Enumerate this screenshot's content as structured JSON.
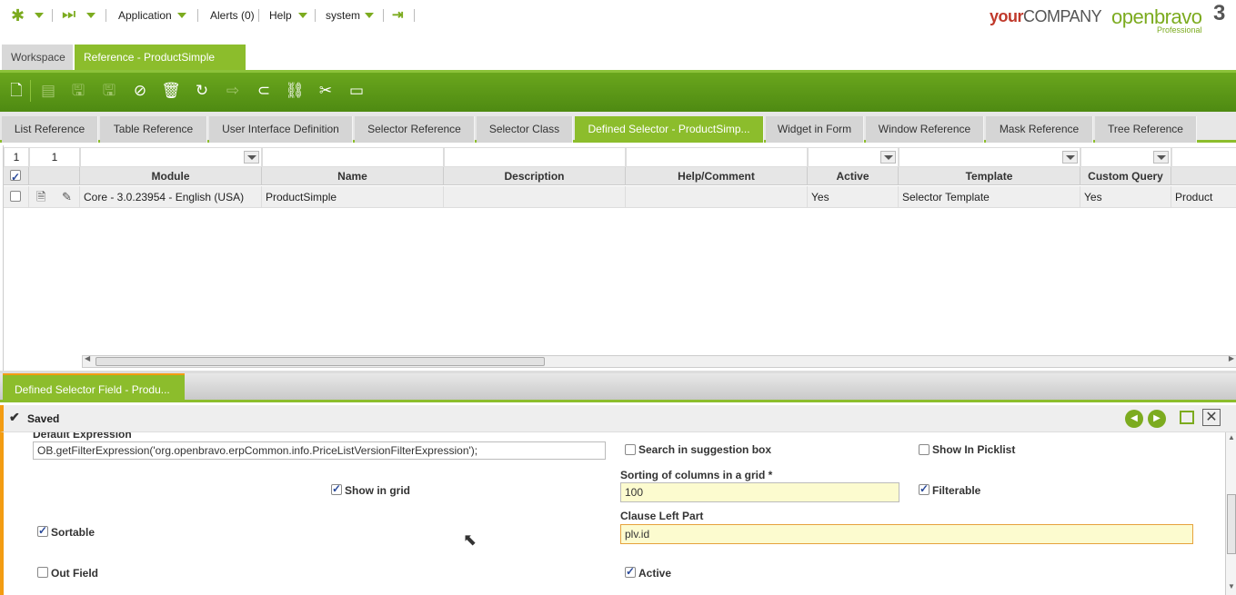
{
  "topnav": {
    "application": "Application",
    "alerts": "Alerts (0)",
    "help": "Help",
    "user": "system",
    "logo_your": "your",
    "logo_company": "COMPANY",
    "logo_openbravo": "openbravo",
    "logo_professional": "Professional",
    "logo_version": "3"
  },
  "window_tabs": {
    "workspace": "Workspace",
    "reference": "Reference - ProductSimple"
  },
  "subtabs": [
    "List Reference",
    "Table Reference",
    "User Interface Definition",
    "Selector Reference",
    "Selector Class",
    "Defined Selector - ProductSimp...",
    "Widget in Form",
    "Window Reference",
    "Mask Reference",
    "Tree Reference"
  ],
  "grid": {
    "row_count": "1",
    "row_count2": "1",
    "headers": [
      "Module",
      "Name",
      "Description",
      "Help/Comment",
      "Active",
      "Template",
      "Custom Query"
    ],
    "row": {
      "module": "Core - 3.0.23954 - English (USA)",
      "name": "ProductSimple",
      "description": "",
      "help": "",
      "active": "Yes",
      "template": "Selector Template",
      "custom_query": "Yes",
      "extra": "Product"
    }
  },
  "form_tab": "Defined Selector Field - Produ...",
  "status": "Saved",
  "form": {
    "default_expression_label": "Default Expression",
    "default_expression_value": "OB.getFilterExpression('org.openbravo.erpCommon.info.PriceListVersionFilterExpression');",
    "search_in_suggestion_box": "Search in suggestion box",
    "search_in_suggestion_box_checked": false,
    "show_in_picklist": "Show In Picklist",
    "show_in_picklist_checked": false,
    "sorting_label": "Sorting of columns in a grid *",
    "sorting_value": "100",
    "show_in_grid": "Show in grid",
    "show_in_grid_checked": true,
    "filterable": "Filterable",
    "filterable_checked": true,
    "sortable": "Sortable",
    "sortable_checked": true,
    "clause_left_part_label": "Clause Left Part",
    "clause_left_part_value": "plv.id",
    "out_field": "Out Field",
    "out_field_checked": false,
    "active": "Active",
    "active_checked": true
  },
  "colors": {
    "accent": "#8cbd2c",
    "toolbar": "#5a9a18",
    "orange": "#f39c12"
  }
}
